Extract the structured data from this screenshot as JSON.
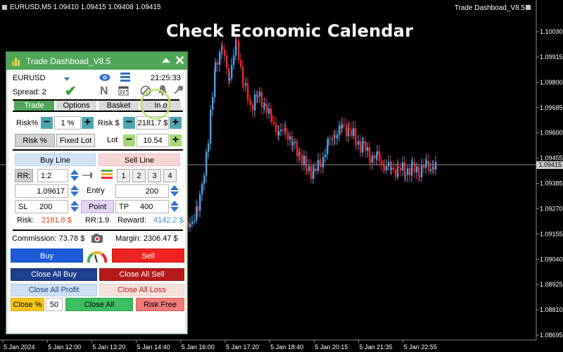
{
  "chart": {
    "symbol_header": "EURUSD,M5  1.09410 1.09415 1.09408 1.09415",
    "indicator_name": "Trade Dashboad_V8.5",
    "headline": "Check Economic Calendar",
    "current_price": "1.09415",
    "colors": {
      "bull": "#4aa3e8",
      "bear": "#e8272a",
      "background": "#000000",
      "grid": "#333333"
    }
  },
  "chart_data": {
    "type": "candlestick",
    "y_ticks": [
      "1.10030",
      "1.09915",
      "1.09800",
      "1.09685",
      "1.09600",
      "1.09455",
      "1.09385",
      "1.09270",
      "1.09155",
      "1.09040",
      "1.08925",
      "1.08810",
      "1.08695"
    ],
    "x_ticks": [
      "5 Jan 2024",
      "5 Jan 12:00",
      "5 Jan 13:20",
      "5 Jan 14:40",
      "5 Jan 16:00",
      "5 Jan 17:20",
      "5 Jan 18:40",
      "5 Jan 20:15",
      "5 Jan 21:35",
      "5 Jan 22:55"
    ],
    "ylim": [
      1.0868,
      1.1005
    ],
    "last_price": 1.09415
  },
  "panel": {
    "title": "Trade Dashboad_V8.5",
    "symbol": "EURUSD",
    "time": "21:25:33",
    "spread": "Spread: 2",
    "tabs": [
      "Trade",
      "Options",
      "Basket",
      "Info"
    ],
    "risk_pct_label": "Risk%",
    "risk_pct_value": "1 %",
    "risk_usd_label": "Risk $",
    "risk_usd_value": "2181.7 $",
    "risk_pct_button": "Risk %",
    "fixed_lot_button": "Fixed Lot",
    "lot_label": "Lot",
    "lot_value": "10.54",
    "buy_line": "Buy Line",
    "sell_line": "Sell Line",
    "rr_label": "RR:",
    "rr_value": "1:2",
    "num_buttons": [
      "1",
      "2",
      "3",
      "4"
    ],
    "entry_price": "1.09617",
    "entry_label": "Entry",
    "entry_points": "200",
    "sl_label": "SL",
    "sl_value": "200",
    "point_button": "Point",
    "tp_label": "TP",
    "tp_value": "400",
    "risk_summary_label": "Risk:",
    "risk_summary_value": "2181.8 $",
    "rr_summary": "RR:1.9",
    "reward_label": "Reward:",
    "reward_value": "4142.2 $",
    "commission": "Commission: 73.78 $",
    "margin": "Margin: 2306.47 $",
    "buy": "Buy",
    "sell": "Sell",
    "close_all_buy": "Close All Buy",
    "close_all_sell": "Close All Sell",
    "close_all_profit": "Close All Profit",
    "close_all_loss": "Close All Loss",
    "close_pct_label": "Close %",
    "close_pct_value": "50",
    "close_all": "Close All",
    "risk_free": "Risk Free"
  }
}
